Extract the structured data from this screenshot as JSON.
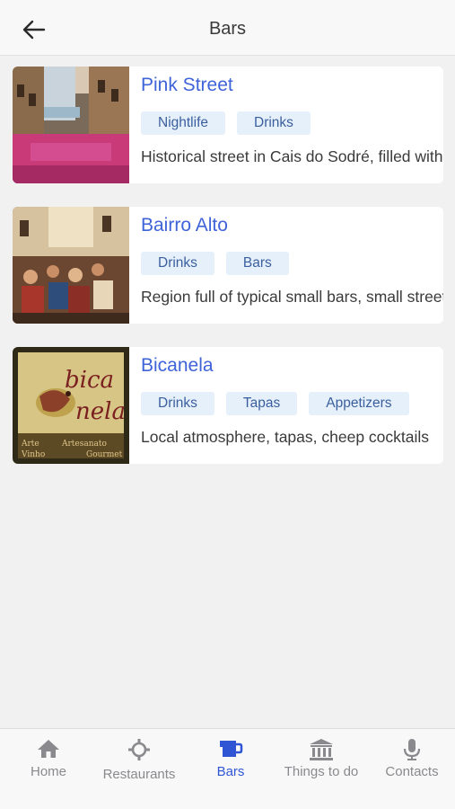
{
  "header": {
    "title": "Bars"
  },
  "items": [
    {
      "title": "Pink Street",
      "tags": [
        "Nightlife",
        "Drinks"
      ],
      "description": "Historical street in Cais do Sodré, filled with bars and clubs"
    },
    {
      "title": "Bairro Alto",
      "tags": [
        "Drinks",
        "Bars"
      ],
      "description": "Region full of typical small bars, small streets and nightlife"
    },
    {
      "title": "Bicanela",
      "tags": [
        "Drinks",
        "Tapas",
        "Appetizers"
      ],
      "description": "Local atmosphere, tapas, cheep cocktails"
    }
  ],
  "tabs": [
    {
      "label": "Home",
      "icon": "home-icon"
    },
    {
      "label": "Restaurants",
      "icon": "restaurant-icon"
    },
    {
      "label": "Bars",
      "icon": "bar-icon",
      "active": true
    },
    {
      "label": "Things to do",
      "icon": "museum-icon"
    },
    {
      "label": "Contacts",
      "icon": "microphone-icon"
    }
  ],
  "colors": {
    "accent": "#2f55d4",
    "title": "#3f63d8",
    "tag_bg": "#e6f0fb"
  }
}
